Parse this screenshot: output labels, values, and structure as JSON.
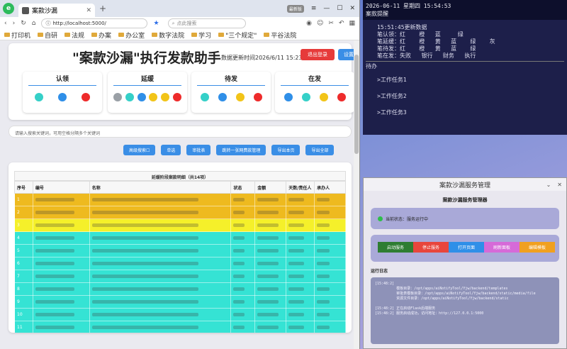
{
  "browser": {
    "tab_title": "案款沙漏",
    "url": "http://localhost:5000/",
    "search_placeholder": "点此搜索",
    "version_badge": "最新版",
    "bookmarks": [
      "打印机",
      "自研",
      "法规",
      "办案",
      "办公室",
      "数字法院",
      "学习",
      "\"三个规定\"",
      "平谷法院"
    ]
  },
  "app": {
    "title": "\"案款沙漏\"执行发款助手",
    "update_time": "数据更新时间2026/6/11 15:23:34",
    "logout_label": "退出登录",
    "settings_label": "设置",
    "stats": [
      {
        "label": "认领",
        "dots": [
          "#35d0c8",
          "#2f8fe8",
          "#ee2b2b"
        ]
      },
      {
        "label": "延缓",
        "dots": [
          "#9aa0a6",
          "#35d0c8",
          "#2f8fe8",
          "#f2c418",
          "#f2c418",
          "#ee2b2b"
        ]
      },
      {
        "label": "待发",
        "dots": [
          "#35d0c8",
          "#2f8fe8",
          "#f2c418",
          "#ee2b2b"
        ]
      },
      {
        "label": "在发",
        "dots": [
          "#2f8fe8",
          "#35d0c8",
          "#f2c418",
          "#ee2b2b"
        ]
      }
    ],
    "search_placeholder": "请输入搜索关键词，可用空格分隔多个关键词",
    "actions": [
      "高级搜索☐",
      "单选",
      "审批表",
      "跳转一张网费款管理",
      "导出本页",
      "导出全部"
    ],
    "table_title": "延缓阶段案款明细（共14项）",
    "columns": [
      "序号",
      "编号",
      "名称",
      "状态",
      "金额",
      "天数/责任人",
      "承办人"
    ],
    "rows": [
      {
        "no": "1",
        "color": "#eeba1f"
      },
      {
        "no": "2",
        "color": "#eeba1f"
      },
      {
        "no": "3",
        "color": "#f5f02a"
      },
      {
        "no": "4",
        "color": "#35e3d4"
      },
      {
        "no": "5",
        "color": "#35e3d4"
      },
      {
        "no": "6",
        "color": "#35e3d4"
      },
      {
        "no": "7",
        "color": "#35e3d4"
      },
      {
        "no": "8",
        "color": "#35e3d4"
      },
      {
        "no": "9",
        "color": "#35e3d4"
      },
      {
        "no": "10",
        "color": "#35e3d4"
      },
      {
        "no": "11",
        "color": "#35e3d4"
      }
    ]
  },
  "terminal": {
    "datetime": "2026-06-11 星期四 15:54:53",
    "header": "案款提醒",
    "update_line": "15:51:45更新数据",
    "lines": [
      "笔认领：红    橙   蓝     绿",
      "笔延缓：红    橙   黄   蓝    绿    灰",
      "笔待发：红    橙   黄   蓝    绿",
      "笔在发：失败   银行   财务   执行"
    ],
    "section": "待办",
    "tasks": [
      ">工作任务1",
      ">工作任务2",
      ">工作任务3"
    ]
  },
  "service": {
    "window_title": "案款沙漏服务管理",
    "subtitle": "案款沙漏服务管理器",
    "status": "当前状态：服务运行中",
    "buttons": [
      {
        "label": "启动服务",
        "color": "#2e7d32"
      },
      {
        "label": "停止服务",
        "color": "#e8453c"
      },
      {
        "label": "打开页面",
        "color": "#2f8fe8"
      },
      {
        "label": "刷新面板",
        "color": "#d66ad8"
      },
      {
        "label": "编辑模板",
        "color": "#f0a020"
      }
    ],
    "log_label": "运行日志",
    "log": "[15:48:2]          \n          模板目录：/opt/apps/aiNotifyTool/Yjw/backend/templates\n          审批表模板目录：/opt/apps/aiNotifyTool/Yjw/backend/static/media/file\n          资源文件目录：/opt/apps/aiNotifyTool/Yjw/backend/static\n\n[15:48:2] 正在启动Flask后端服务\n[15:48:2] 服务启动成功，访问地址：http://127.0.0.1:5000"
  }
}
